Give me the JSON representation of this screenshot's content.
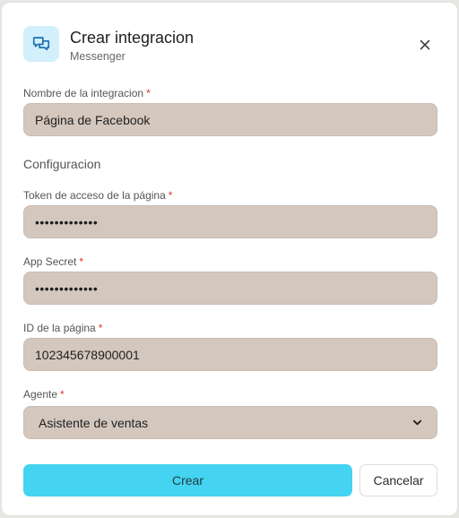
{
  "dialog": {
    "title": "Crear integracion",
    "subtitle": "Messenger",
    "icon": "messenger-chat-icon",
    "close_icon": "close-icon"
  },
  "fields": {
    "integration_name": {
      "label": "Nombre de la integracion",
      "required_mark": "*",
      "value": "Página de Facebook"
    },
    "section_title": "Configuracion",
    "access_token": {
      "label": "Token de acceso de la página",
      "required_mark": "*",
      "value": "•••••••••••••"
    },
    "app_secret": {
      "label": "App Secret",
      "required_mark": "*",
      "value": "•••••••••••••"
    },
    "page_id": {
      "label": "ID de la página",
      "required_mark": "*",
      "value": "102345678900001"
    },
    "agent": {
      "label": "Agente",
      "required_mark": "*",
      "selected": "Asistente de ventas"
    }
  },
  "actions": {
    "create_label": "Crear",
    "cancel_label": "Cancelar"
  },
  "colors": {
    "accent": "#44d3f0",
    "field_bg": "#d4c7bd",
    "icon_bg": "#d3effc",
    "required": "#e0322b"
  }
}
